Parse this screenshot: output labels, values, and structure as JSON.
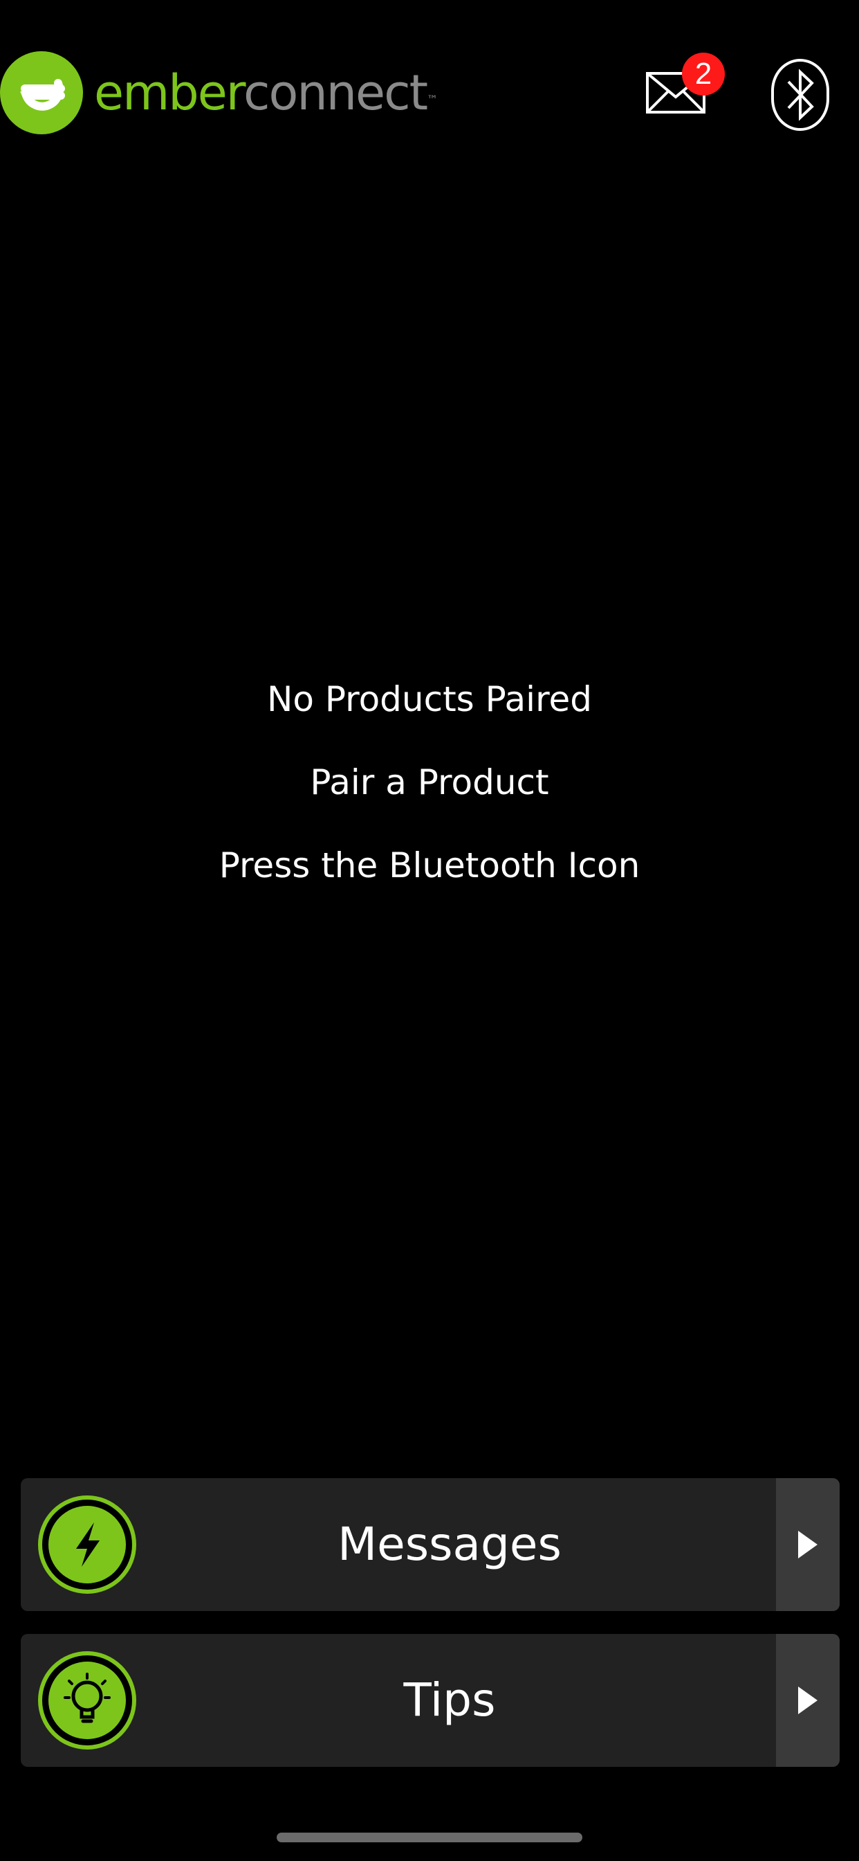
{
  "header": {
    "brand_part1": "ember",
    "brand_part2": "connect",
    "brand_tm": "™",
    "mail_icon": "envelope-icon",
    "mail_badge_count": "2",
    "bluetooth_icon": "bluetooth-icon"
  },
  "empty_state": {
    "title": "No Products Paired",
    "line2": "Pair a Product",
    "line3": "Press the Bluetooth Icon"
  },
  "cards": [
    {
      "label": "Messages",
      "icon": "lightning-icon"
    },
    {
      "label": "Tips",
      "icon": "lightbulb-icon"
    }
  ],
  "colors": {
    "brand_green": "#7dc51b",
    "badge_red": "#ff1a1a",
    "card_bg": "#222222",
    "arrow_bg": "#3a3a3a"
  }
}
